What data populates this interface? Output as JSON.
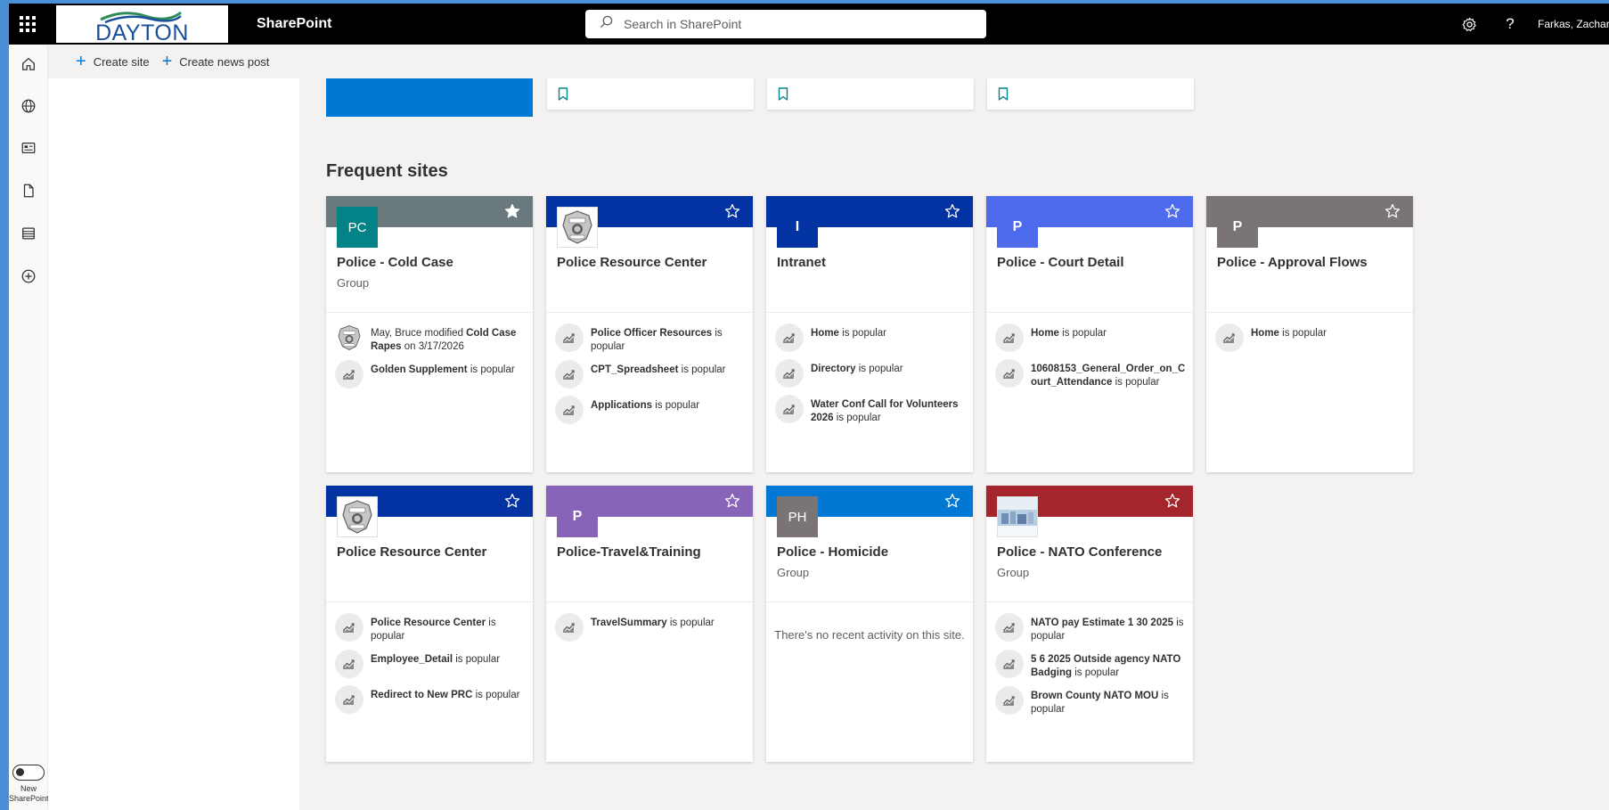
{
  "header": {
    "logo_text": "DAYTON",
    "app_name": "SharePoint",
    "search_placeholder": "Search in SharePoint",
    "user_name": "Farkas, Zachary"
  },
  "appbar": {
    "items": [
      "home",
      "sites",
      "news",
      "files",
      "lists",
      "create"
    ],
    "toggle_label": "New SharePoint"
  },
  "commands": {
    "create_site": "Create site",
    "create_news_post": "Create news post"
  },
  "frequent_sites": {
    "title": "Frequent sites",
    "cards": [
      {
        "name": "Police - Cold Case",
        "type": "Group",
        "initials": "PC",
        "banner_color": "#69797e",
        "tile_color": "#038387",
        "starred": true,
        "activities": [
          {
            "pre": "May, Bruce modified ",
            "bold": "Cold Case Rapes",
            "post": " on 3/17/2026",
            "icon": "badge"
          },
          {
            "pre": "",
            "bold": "Golden Supplement",
            "post": " is popular",
            "icon": "trend"
          }
        ]
      },
      {
        "name": "Police Resource Center",
        "type": "",
        "initials": "",
        "banner_color": "#0332a3",
        "tile_color": "#ffffff",
        "starred": false,
        "logo": "badge",
        "activities": [
          {
            "pre": "",
            "bold": "Police Officer Resources",
            "post": " is popular",
            "icon": "trend"
          },
          {
            "pre": "",
            "bold": "CPT_Spreadsheet",
            "post": " is popular",
            "icon": "trend"
          },
          {
            "pre": "",
            "bold": "Applications",
            "post": " is popular",
            "icon": "trend"
          }
        ]
      },
      {
        "name": "Intranet",
        "type": "",
        "initials": "I",
        "banner_color": "#0332a3",
        "tile_color": "#0332a3",
        "starred": false,
        "activities": [
          {
            "pre": "",
            "bold": "Home",
            "post": " is popular",
            "icon": "trend"
          },
          {
            "pre": "",
            "bold": "Directory",
            "post": " is popular",
            "icon": "trend"
          },
          {
            "pre": "",
            "bold": "Water Conf Call for Volunteers 2026",
            "post": " is popular",
            "icon": "trend"
          }
        ]
      },
      {
        "name": "Police - Court Detail",
        "type": "",
        "initials": "P",
        "banner_color": "#4f6bed",
        "tile_color": "#4f6bed",
        "starred": false,
        "activities": [
          {
            "pre": "",
            "bold": "Home",
            "post": " is popular",
            "icon": "trend"
          },
          {
            "pre": "",
            "bold": "10608153_General_Order_on_Court_Attendance",
            "post": " is popular",
            "icon": "trend"
          }
        ]
      },
      {
        "name": "Police - Approval Flows",
        "type": "",
        "initials": "P",
        "banner_color": "#7a7574",
        "tile_color": "#7a7574",
        "starred": false,
        "activities": [
          {
            "pre": "",
            "bold": "Home",
            "post": " is popular",
            "icon": "trend"
          }
        ]
      },
      {
        "name": "Police Resource Center",
        "type": "",
        "initials": "",
        "banner_color": "#0332a3",
        "tile_color": "#ffffff",
        "starred": false,
        "logo": "badge",
        "activities": [
          {
            "pre": "",
            "bold": "Police Resource Center",
            "post": " is popular",
            "icon": "trend"
          },
          {
            "pre": "",
            "bold": "Employee_Detail",
            "post": " is popular",
            "icon": "trend"
          },
          {
            "pre": "",
            "bold": "Redirect to New PRC",
            "post": " is popular",
            "icon": "trend"
          }
        ]
      },
      {
        "name": "Police-Travel&Training",
        "type": "",
        "initials": "P",
        "banner_color": "#8764b8",
        "tile_color": "#8764b8",
        "starred": false,
        "activities": [
          {
            "pre": "",
            "bold": "TravelSummary",
            "post": " is popular",
            "icon": "trend"
          }
        ]
      },
      {
        "name": "Police - Homicide",
        "type": "Group",
        "initials": "PH",
        "banner_color": "#0078d4",
        "tile_color": "#7a7574",
        "starred": false,
        "activities": [],
        "empty_text": "There's no recent activity on this site."
      },
      {
        "name": "Police - NATO Conference",
        "type": "Group",
        "initials": "",
        "banner_color": "#a4262c",
        "tile_color": "#ffffff",
        "starred": false,
        "logo": "photo",
        "activities": [
          {
            "pre": "",
            "bold": "NATO pay Estimate 1 30 2025",
            "post": " is popular",
            "icon": "trend"
          },
          {
            "pre": "",
            "bold": "5 6 2025 Outside agency NATO Badging",
            "post": " is popular",
            "icon": "trend"
          },
          {
            "pre": "",
            "bold": "Brown County NATO MOU",
            "post": " is popular",
            "icon": "trend"
          }
        ]
      }
    ]
  }
}
